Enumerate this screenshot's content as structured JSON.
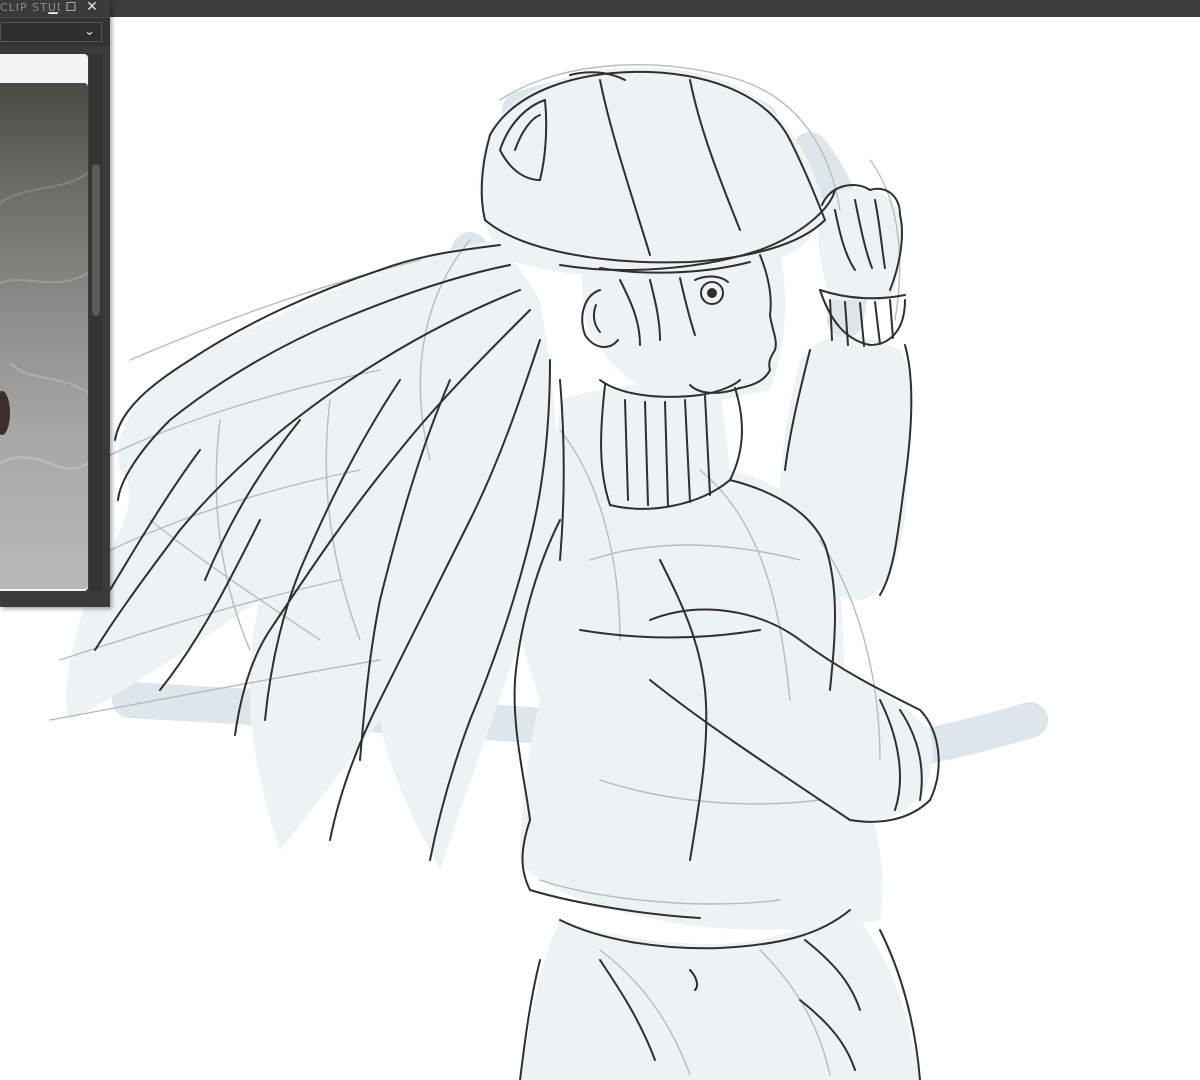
{
  "app": {
    "title": "CLIP STUDIO PAINT"
  },
  "reference_window": {
    "title": "CLIP STUDIO",
    "minimize_icon": "minimize-icon",
    "maximize_icon": "maximize-icon",
    "close_icon": "close-icon",
    "dropdown_icon": "chevron-down-icon"
  },
  "colors": {
    "chrome": "#3c3c3c",
    "canvas": "#ffffff",
    "blue_sketch": "#dde6ea",
    "line_art": "#2f2f2f"
  }
}
